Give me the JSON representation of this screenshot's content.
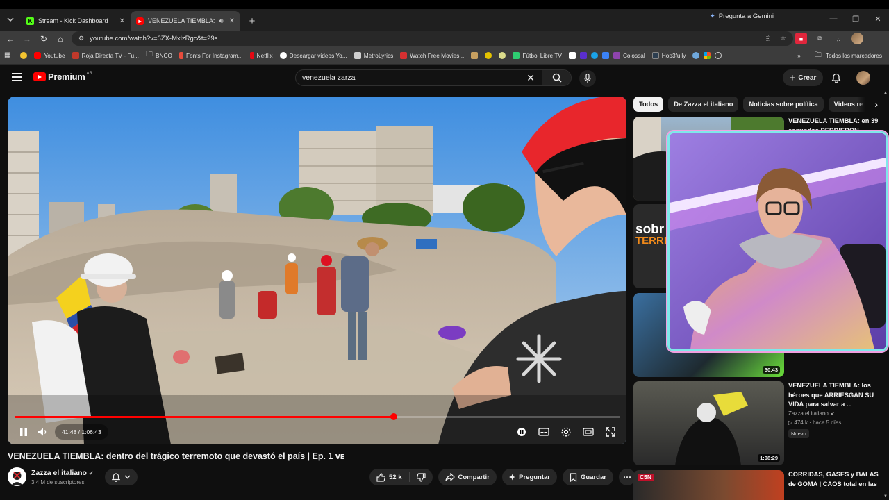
{
  "browser": {
    "tabs": [
      {
        "title": "Stream - Kick Dashboard",
        "favicon": "kick-icon",
        "color": "#53fc18",
        "active": false
      },
      {
        "title": "VENEZUELA TIEMBLA: dent",
        "favicon": "youtube-icon",
        "color": "#ff0000",
        "active": true
      }
    ],
    "gemini_label": "Pregunta a Gemini",
    "url": "youtube.com/watch?v=6ZX-MxlzRgc&t=29s",
    "bookmarks": [
      {
        "label": "",
        "icon": "emoji-icon",
        "color": "#f4c430"
      },
      {
        "label": "Youtube",
        "icon": "youtube-icon",
        "color": "#ff0000"
      },
      {
        "label": "Roja Directa TV - Fu...",
        "icon": "roja-icon",
        "color": "#c0392b"
      },
      {
        "label": "BNCO",
        "icon": "folder-icon",
        "color": "#c7c7c7"
      },
      {
        "label": "Fonts For Instagram...",
        "icon": "fonts-icon",
        "color": "#e74c3c"
      },
      {
        "label": "Netflix",
        "icon": "netflix-icon",
        "color": "#e50914"
      },
      {
        "label": "Descargar videos Yo...",
        "icon": "download-icon",
        "color": "#ffffff"
      },
      {
        "label": "MetroLyrics",
        "icon": "metrolyrics-icon",
        "color": "#d0d0d0"
      },
      {
        "label": "Watch Free Movies...",
        "icon": "movies-icon",
        "color": "#d63031"
      },
      {
        "label": "Fútbol Libre TV",
        "icon": "futbol-icon",
        "color": "#2ecc71"
      },
      {
        "label": "Colossal",
        "icon": "colossal-icon",
        "color": "#8e44ad"
      },
      {
        "label": "Hop3fully",
        "icon": "hop3fully-icon",
        "color": "#2c3e50"
      }
    ],
    "bookmarks_all": "Todos los marcadores"
  },
  "youtube": {
    "logo_text": "Premium",
    "region": "AR",
    "search_query": "venezuela zarza",
    "create_label": "Crear"
  },
  "player": {
    "current_time": "41:48",
    "duration": "1:06:43",
    "time_display": "41:48 / 1:06:43",
    "progress": 0.6265
  },
  "video": {
    "title": "VENEZUELA TIEMBLA: dentro del trágico terremoto que devastó el país | Ep. 1 ᴠᴇ",
    "channel": "Zazza el italiano",
    "subscribers": "3.4 M de suscriptores",
    "likes": "52 k",
    "share_label": "Compartir",
    "ask_label": "Preguntar",
    "save_label": "Guardar"
  },
  "chips": [
    "Todos",
    "De Zazza el italiano",
    "Noticias sobre política",
    "Videos re"
  ],
  "recommendations": [
    {
      "title": "VENEZUELA TIEMBLA: en 39 segundos PERDIERON",
      "duration": ""
    },
    {
      "title": "",
      "duration": ""
    },
    {
      "title": "",
      "duration": "30:43"
    },
    {
      "title": "VENEZUELA TIEMBLA: los héroes que ARRIESGAN SU VIDA para salvar a ...",
      "channel": "Zazza el italiano",
      "views": "474 k",
      "age": "hace 5 días",
      "badge": "Nuevo",
      "duration": "1:08:29"
    },
    {
      "title": "CORRIDAS, GASES y BALAS de GOMA | CAOS total en las",
      "duration": "",
      "thumb_label": "C5N"
    }
  ],
  "thumb_texts": {
    "sobre": "sobr",
    "terremoto": "TERREM"
  }
}
